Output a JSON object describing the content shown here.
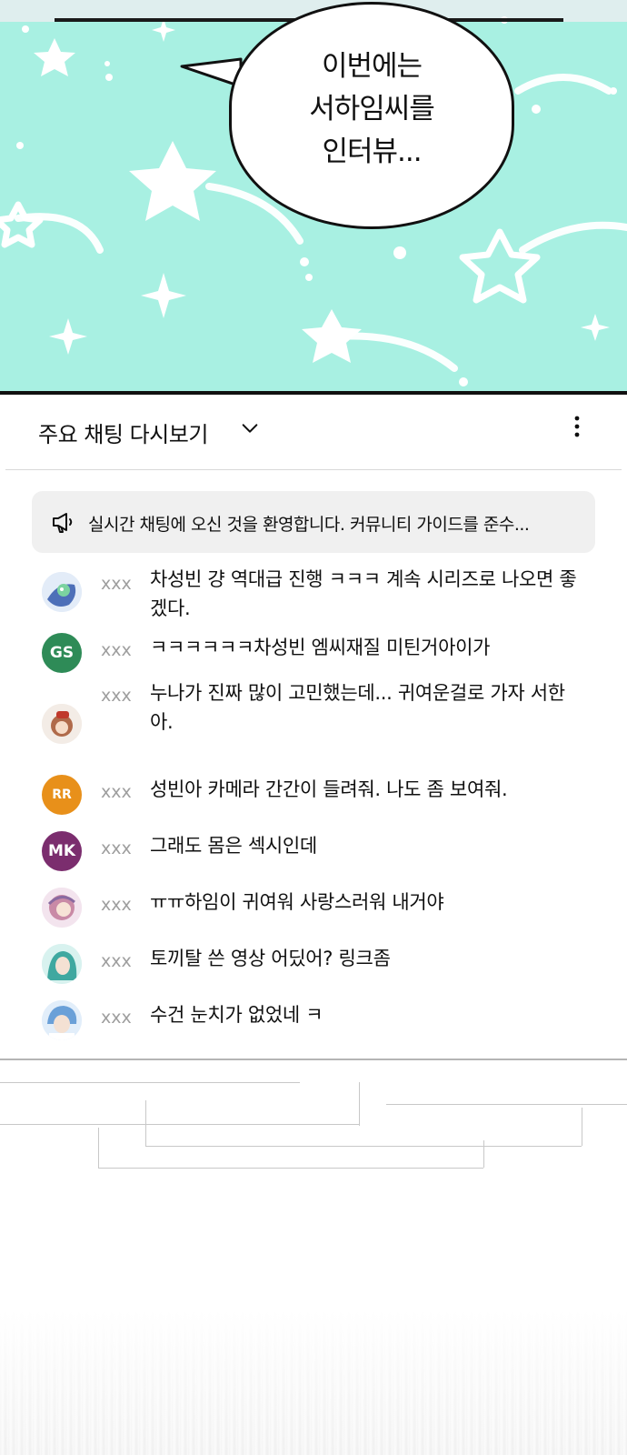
{
  "comic": {
    "bubble_lines": [
      "이번에는",
      "서하임씨를",
      "인터뷰..."
    ]
  },
  "chat": {
    "title": "주요 채팅 다시보기",
    "banner_text": "실시간 채팅에 오신 것을 환영합니다. 커뮤니티 가이드를 준수...",
    "messages": [
      {
        "author": "xxx",
        "text": "차성빈 걍 역대급 진행 ㅋㅋㅋ 계속 시리즈로 나오면 좋겠다.",
        "avatar": {
          "type": "image",
          "color": "#5b7ec0"
        }
      },
      {
        "author": "xxx",
        "text": "ㅋㅋㅋㅋㅋㅋ차성빈 엠씨재질 미틴거아이가",
        "avatar": {
          "type": "initials",
          "initials": "GS",
          "color": "#2e8b57"
        }
      },
      {
        "author": "xxx",
        "text": "누나가 진짜 많이 고민했는데... 귀여운걸로 가자 서한아.",
        "avatar": {
          "type": "image",
          "color": "#b06a4a"
        }
      },
      {
        "author": "xxx",
        "text": "성빈아 카메라 간간이 들려줘. 나도 좀 보여줘.",
        "avatar": {
          "type": "initials",
          "initials": "RR",
          "color": "#e8901a"
        }
      },
      {
        "author": "xxx",
        "text": "그래도 몸은 섹시인데",
        "avatar": {
          "type": "initials",
          "initials": "MK",
          "color": "#7b2d6e"
        }
      },
      {
        "author": "xxx",
        "text": "ㅠㅠ하임이 귀여워 사랑스러워 내거야",
        "avatar": {
          "type": "image",
          "color": "#c98aa6"
        }
      },
      {
        "author": "xxx",
        "text": "토끼탈 쓴 영상 어딨어? 링크좀",
        "avatar": {
          "type": "image",
          "color": "#3fa8a0"
        }
      },
      {
        "author": "xxx",
        "text": "수건 눈치가 없었네 ㅋ",
        "avatar": {
          "type": "image",
          "color": "#6aa0d8"
        }
      }
    ]
  },
  "icons": {
    "chevron": "chevron-down-icon",
    "more": "more-vert-icon",
    "megaphone": "megaphone-icon"
  },
  "colors": {
    "comic_bg": "#a8f0e2",
    "banner_bg": "#f0f0f0",
    "author": "#9e9e9e"
  }
}
